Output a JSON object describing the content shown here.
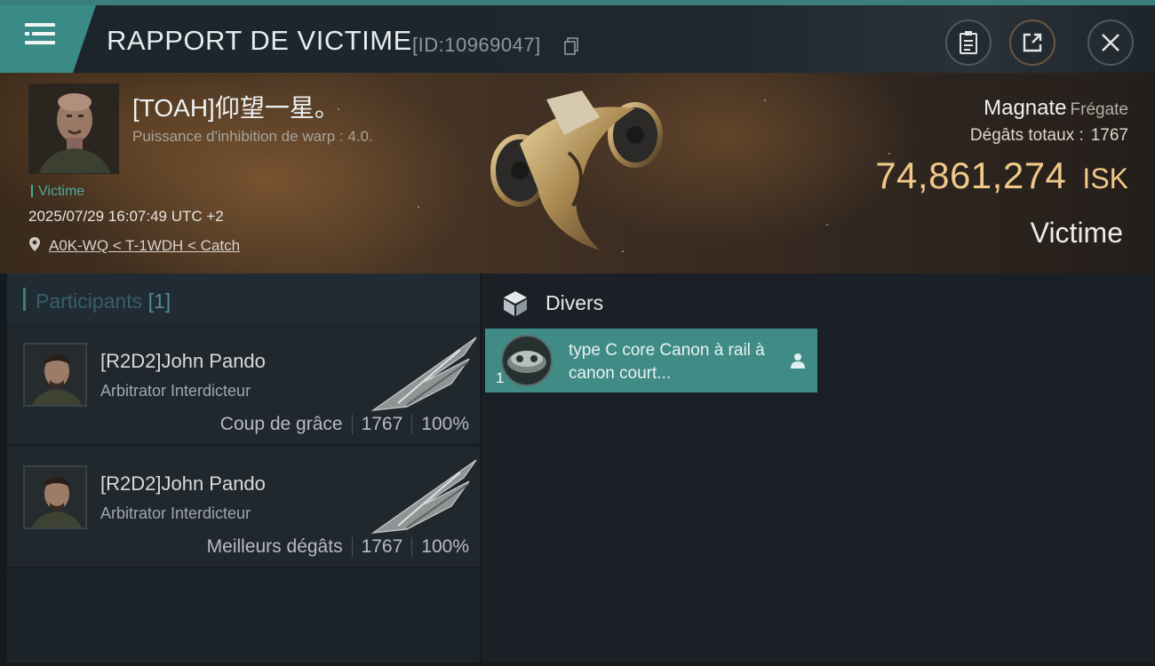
{
  "header": {
    "title": "RAPPORT DE VICTIME",
    "report_id": "[ID:10969047]",
    "icons": [
      "menu-icon",
      "copy-icon",
      "clipboard-icon",
      "share-icon",
      "close-icon"
    ]
  },
  "victim": {
    "name": "[TOAH]仰望一星。",
    "subtitle": "Puissance d'inhibition de warp : 4.0.",
    "role_tag": "Victime",
    "datetime": "2025/07/29 16:07:49 UTC +2",
    "location": "A0K-WQ < T-1WDH < Catch",
    "ship_name": "Magnate",
    "ship_class": "Frégate",
    "damage_label": "Dégâts totaux :",
    "damage_value": "1767",
    "isk_value": "74,861,274",
    "isk_unit": "ISK",
    "status": "Victime"
  },
  "participants": {
    "label": "Participants",
    "count": "[1]",
    "rows": [
      {
        "name": "[R2D2]John Pando",
        "ship": "Arbitrator Interdicteur",
        "blow": "Coup de grâce",
        "damage": "1767",
        "percent": "100%"
      },
      {
        "name": "[R2D2]John Pando",
        "ship": "Arbitrator Interdicteur",
        "blow": "Meilleurs dégâts",
        "damage": "1767",
        "percent": "100%"
      }
    ]
  },
  "divers": {
    "title": "Divers",
    "items": [
      {
        "quantity": "1",
        "name": "type C core Canon à rail à canon court..."
      }
    ]
  },
  "colors": {
    "accent_teal": "#3a8a85",
    "isk_gold": "#f0c888",
    "victim_tag": "#4fa8a0"
  }
}
